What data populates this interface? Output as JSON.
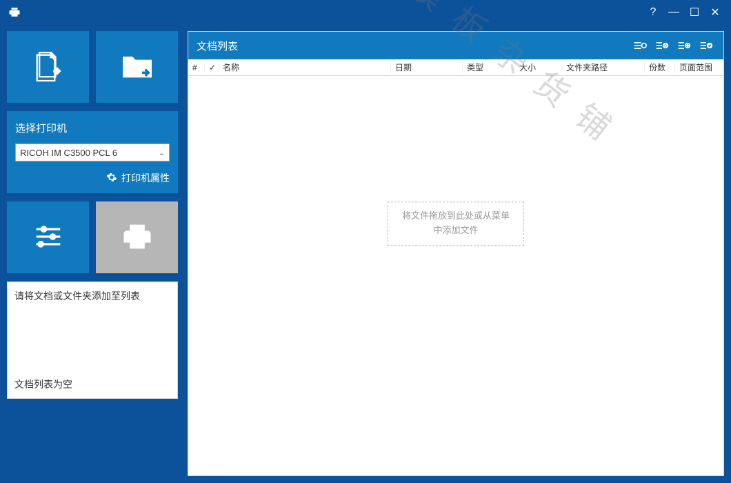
{
  "titlebar": {
    "help": "?",
    "min": "—",
    "max": "☐",
    "close": "✕"
  },
  "sidebar": {
    "printer_label": "选择打印机",
    "printer_selected": "RICOH IM C3500 PCL 6",
    "printer_props": "打印机属性",
    "info_msg1": "请将文档或文件夹添加至列表",
    "info_msg2": "文档列表为空"
  },
  "content": {
    "title": "文档列表",
    "columns": {
      "num": "#",
      "check": "✓",
      "name": "名称",
      "date": "日期",
      "type": "类型",
      "size": "大小",
      "path": "文件夹路径",
      "copies": "份数",
      "range": "页面范围"
    },
    "drop_hint_l1": "将文件拖放到此处或从菜单",
    "drop_hint_l2": "中添加文件"
  },
  "watermark": "素材模板杂货铺"
}
